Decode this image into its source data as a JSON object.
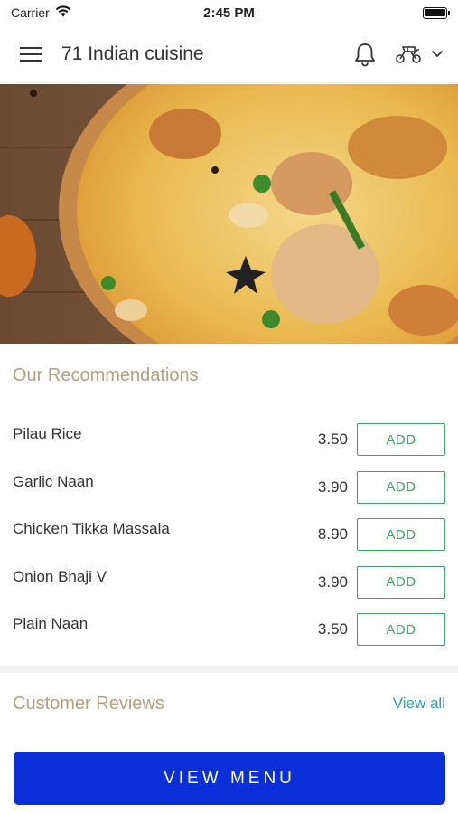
{
  "status_bar": {
    "carrier": "Carrier",
    "time": "2:45 PM"
  },
  "nav": {
    "title": "71 Indian cuisine",
    "icons": [
      "menu-icon",
      "bell-icon",
      "scooter-icon",
      "chevron-down-icon"
    ]
  },
  "recommendations": {
    "title": "Our Recommendations",
    "items": [
      {
        "name": "Pilau Rice",
        "price": "3.50",
        "action": "ADD"
      },
      {
        "name": "Garlic Naan",
        "price": "3.90",
        "action": "ADD"
      },
      {
        "name": "Chicken Tikka Massala",
        "price": "8.90",
        "action": "ADD"
      },
      {
        "name": "Onion Bhaji V",
        "price": "3.90",
        "action": "ADD"
      },
      {
        "name": "Plain Naan",
        "price": "3.50",
        "action": "ADD"
      }
    ]
  },
  "reviews": {
    "title": "Customer Reviews",
    "view_all": "View all"
  },
  "cta": {
    "label": "VIEW MENU"
  },
  "colors": {
    "accent_green": "#3fa564",
    "cta_blue": "#0a2fd6",
    "section_title": "#b5a07e",
    "link": "#2a9fbf"
  }
}
